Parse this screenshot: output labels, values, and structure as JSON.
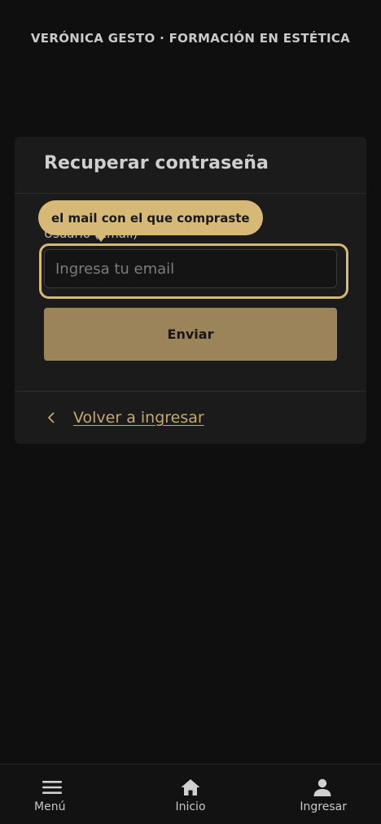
{
  "brand": {
    "title": "VERÓNICA GESTO · FORMACIÓN EN ESTÉTICA"
  },
  "card": {
    "title": "Recuperar contraseña",
    "field_label": "Usuario (Email)",
    "tooltip": "el mail con el que compraste",
    "email_placeholder": "Ingresa tu email",
    "email_value": "",
    "submit_label": "Enviar",
    "back_link": "Volver a ingresar"
  },
  "bottom_nav": {
    "items": [
      {
        "label": "Menú",
        "icon": "menu-icon"
      },
      {
        "label": "Inicio",
        "icon": "home-icon"
      },
      {
        "label": "Ingresar",
        "icon": "user-icon"
      }
    ]
  },
  "colors": {
    "background": "#0f0f0f",
    "card": "#1b1b1b",
    "accent": "#d6b877",
    "button": "#9b845a",
    "link": "#c7a86e"
  }
}
